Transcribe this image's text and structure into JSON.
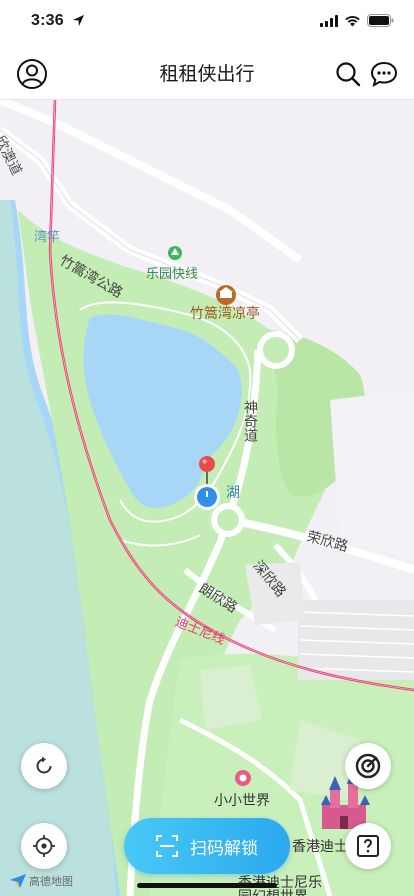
{
  "status": {
    "time": "3:36"
  },
  "nav": {
    "title": "租租侠出行"
  },
  "map": {
    "roads": {
      "r1": "欣澳道",
      "r2": "竹篙湾公路",
      "r3": "神奇道",
      "r4": "荣欣路",
      "r5": "深欣路",
      "r6": "朗欣路",
      "r7": "迪士尼线"
    },
    "places": {
      "bay": "湾竿",
      "station": "乐园快线",
      "pavilion": "竹篙湾凉亭",
      "lake": "湖",
      "small_world": "小小世界",
      "disney": "香港迪士尼乐",
      "disney2": "香港迪士尼乐",
      "disney3": "园幻想世界"
    },
    "logo_text": "高德地图"
  },
  "scan_button": {
    "label": "扫码解锁"
  },
  "colors": {
    "accent": "#2aa9ee",
    "green": "#c3edb4",
    "water": "#a8d6f7",
    "rail": "#e83c72",
    "pin_red": "#e94b4b",
    "location_blue": "#2f8fe9"
  }
}
